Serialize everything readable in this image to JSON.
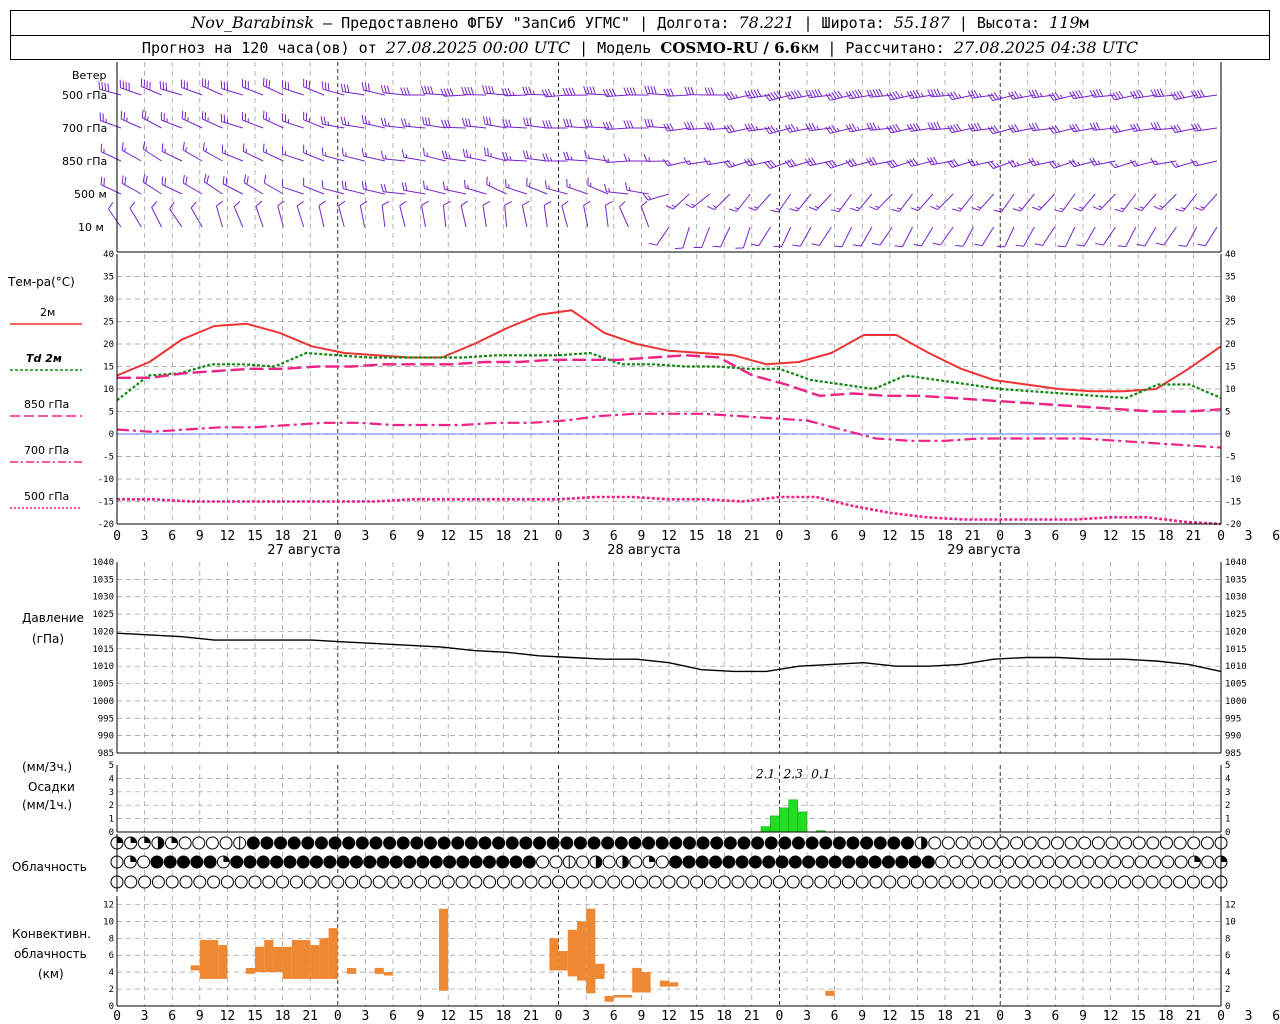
{
  "header": {
    "station": "Nov_Barabinsk",
    "provider": "— Предоставлено ФГБУ \"ЗапСиб УГМС\"",
    "lon_label": "Долгота:",
    "lon": "78.221",
    "lat_label": "Широта:",
    "lat": "55.187",
    "alt_label": "Высота:",
    "alt": "119",
    "alt_unit": "м",
    "forecast_prefix": "Прогноз на 120 часа(ов) от",
    "forecast_from": "27.08.2025 00:00 UTC",
    "model_label": "Модель",
    "model": "COSMO-RU / 6.6",
    "model_unit": "км",
    "calc_label": "Рассчитано:",
    "calc_time": "27.08.2025 04:38 UTC"
  },
  "labels": {
    "wind": "Ветер",
    "wind_levels": [
      "500 гПа",
      "700 гПа",
      "850 гПа",
      "500 м",
      "10 м"
    ],
    "temp_title": "Тем-ра(°C)",
    "temp_legend": [
      "2м",
      "Td 2м",
      "850 гПа",
      "700 гПа",
      "500 гПа"
    ],
    "pressure_title": "Давление",
    "pressure_unit": "(гПа)",
    "precip_unit3": "(мм/3ч.)",
    "precip_title": "Осадки",
    "precip_unit1": "(мм/1ч.)",
    "cloud_title": "Облачность",
    "conv_title1": "Конвективн.",
    "conv_title2": "облачность",
    "conv_unit": "(км)",
    "days": [
      "27 августа",
      "28 августа",
      "29 августа"
    ]
  },
  "colors": {
    "t2m": "#ee3333",
    "td2m": "#118811",
    "t850": "#ee2288",
    "t700": "#ee2288",
    "t500": "#ee2288",
    "wind": "#7722cc",
    "precip": "#22dd22",
    "conv": "#ee8833"
  },
  "chart_data": [
    {
      "type": "line",
      "title": "Тем-ра(°C)",
      "x_hours": [
        0,
        3,
        6,
        9,
        12,
        15,
        18,
        21,
        24,
        27,
        30,
        33,
        36,
        39,
        42,
        45,
        48,
        51,
        54,
        57,
        60,
        63,
        66,
        69,
        72,
        75,
        78,
        81,
        84,
        87,
        90,
        93,
        96,
        99,
        102,
        105,
        108,
        111,
        114,
        117,
        120
      ],
      "x_tick_labels": [
        "0",
        "3",
        "6",
        "9",
        "12",
        "15",
        "18",
        "21",
        "0",
        "3",
        "6",
        "9",
        "12",
        "15",
        "18",
        "21",
        "0",
        "3",
        "6",
        "9",
        "12",
        "15",
        "18",
        "21",
        "0",
        "3",
        "6",
        "9",
        "12",
        "15",
        "18",
        "21",
        "0",
        "3",
        "6",
        "9",
        "12",
        "15",
        "18",
        "21",
        "0",
        "3",
        "6"
      ],
      "ylim": [
        -20,
        40
      ],
      "y_ticks": [
        40,
        35,
        30,
        25,
        20,
        15,
        10,
        5,
        0,
        -5,
        -10,
        -15,
        -20
      ],
      "series": [
        {
          "name": "2м",
          "values": [
            13,
            16,
            21,
            24,
            24.5,
            22.5,
            19.5,
            18,
            17.5,
            17,
            17,
            20,
            23.5,
            26.5,
            27.5,
            22.5,
            20,
            18.5,
            18,
            17.5,
            15.5,
            16,
            18,
            22,
            22,
            18,
            14.5,
            12,
            11,
            10,
            9.5,
            9.5,
            10,
            14.5,
            19.5
          ]
        },
        {
          "name": "Td 2м",
          "values": [
            7.5,
            13,
            13.5,
            15.5,
            15.5,
            15,
            18,
            17.5,
            17,
            17,
            17,
            17,
            17.5,
            17.5,
            17.5,
            18,
            15.5,
            15.5,
            15,
            15,
            14.5,
            14.5,
            12,
            11,
            10,
            13,
            12,
            11,
            10,
            9.5,
            9,
            8.5,
            8,
            11,
            11,
            8
          ]
        },
        {
          "name": "850 гПа",
          "values": [
            12.5,
            12.5,
            13.5,
            14,
            14.5,
            14.5,
            15,
            15,
            15.5,
            15.5,
            15.5,
            16,
            16,
            16.5,
            16.5,
            16.5,
            17,
            17.5,
            17,
            13,
            11,
            8.5,
            9,
            8.5,
            8.5,
            8,
            7.5,
            7,
            6.5,
            6,
            5.5,
            5,
            5,
            5.5
          ]
        },
        {
          "name": "700 гПа",
          "values": [
            1,
            0.5,
            1,
            1.5,
            1.5,
            2,
            2.5,
            2.5,
            2,
            2,
            2,
            2.5,
            2.5,
            3,
            4,
            4.5,
            4.5,
            4.5,
            4,
            3.5,
            3,
            1,
            -1,
            -1.5,
            -1.5,
            -1,
            -1,
            -1,
            -1,
            -1.5,
            -2,
            -2.5,
            -3
          ]
        },
        {
          "name": "500 гПа",
          "values": [
            -14.5,
            -14.5,
            -15,
            -15,
            -15,
            -15,
            -15,
            -15,
            -14.5,
            -14.5,
            -14.5,
            -14.5,
            -14.5,
            -14,
            -14,
            -14.5,
            -14.5,
            -15,
            -14,
            -14,
            -16,
            -17.5,
            -18.5,
            -19,
            -19,
            -19,
            -19,
            -18.5,
            -18.5,
            -19.5,
            -20
          ]
        }
      ]
    },
    {
      "type": "line",
      "title": "Давление",
      "ylabel": "(гПа)",
      "ylim": [
        985,
        1040
      ],
      "y_ticks": [
        1040,
        1035,
        1030,
        1025,
        1020,
        1015,
        1010,
        1005,
        1000,
        995,
        990,
        985
      ],
      "series": [
        {
          "values": [
            1019.5,
            1019,
            1018.5,
            1017.5,
            1017.5,
            1017.5,
            1017.5,
            1017,
            1016.5,
            1016,
            1015.5,
            1014.5,
            1014,
            1013,
            1012.5,
            1012,
            1012,
            1011,
            1009,
            1008.5,
            1008.5,
            1010,
            1010.5,
            1011,
            1010,
            1010,
            1010.5,
            1012,
            1012.5,
            1012.5,
            1012,
            1012,
            1011.5,
            1010.5,
            1008.5
          ]
        }
      ]
    },
    {
      "type": "bar",
      "title": "Осадки",
      "ylabel": "(мм/3ч.) (мм/1ч.)",
      "ylim": [
        0,
        5
      ],
      "y_ticks": [
        5,
        4,
        3,
        2,
        1,
        0
      ],
      "bars": [
        {
          "hour": 70,
          "value": 0.4
        },
        {
          "hour": 71,
          "value": 1.2
        },
        {
          "hour": 72,
          "value": 1.8
        },
        {
          "hour": 73,
          "value": 2.4
        },
        {
          "hour": 74,
          "value": 1.5
        },
        {
          "hour": 76,
          "value": 0.1
        }
      ],
      "annotations": [
        {
          "hour": 70.5,
          "text": "2.1"
        },
        {
          "hour": 73.5,
          "text": "2.3"
        },
        {
          "hour": 76.5,
          "text": "0.1"
        }
      ]
    },
    {
      "type": "bar",
      "title": "Конвективн. облачность",
      "ylabel": "(км)",
      "ylim": [
        0,
        13
      ],
      "y_ticks": [
        12,
        10,
        8,
        6,
        4,
        2,
        0
      ],
      "ranges": [
        {
          "h0": 8,
          "h1": 9,
          "bottom": 4.2,
          "top": 4.8
        },
        {
          "h0": 9,
          "h1": 11,
          "bottom": 3.2,
          "top": 7.8
        },
        {
          "h0": 11,
          "h1": 12,
          "bottom": 3.2,
          "top": 7.2
        },
        {
          "h0": 14,
          "h1": 15,
          "bottom": 3.8,
          "top": 4.5
        },
        {
          "h0": 15,
          "h1": 16,
          "bottom": 4,
          "top": 7
        },
        {
          "h0": 16,
          "h1": 17,
          "bottom": 4,
          "top": 7.8
        },
        {
          "h0": 17,
          "h1": 18,
          "bottom": 4,
          "top": 7
        },
        {
          "h0": 18,
          "h1": 19,
          "bottom": 3.2,
          "top": 7
        },
        {
          "h0": 19,
          "h1": 21,
          "bottom": 3.2,
          "top": 7.8
        },
        {
          "h0": 21,
          "h1": 22,
          "bottom": 3.2,
          "top": 7.2
        },
        {
          "h0": 22,
          "h1": 23,
          "bottom": 3.2,
          "top": 8
        },
        {
          "h0": 23,
          "h1": 24,
          "bottom": 3.2,
          "top": 9.2
        },
        {
          "h0": 25,
          "h1": 26,
          "bottom": 3.8,
          "top": 4.5
        },
        {
          "h0": 28,
          "h1": 29,
          "bottom": 3.8,
          "top": 4.5
        },
        {
          "h0": 29,
          "h1": 30,
          "bottom": 3.6,
          "top": 4.0
        },
        {
          "h0": 35,
          "h1": 36,
          "bottom": 1.8,
          "top": 11.5
        },
        {
          "h0": 47,
          "h1": 48,
          "bottom": 4.2,
          "top": 8
        },
        {
          "h0": 48,
          "h1": 49,
          "bottom": 4.2,
          "top": 6.5
        },
        {
          "h0": 49,
          "h1": 50,
          "bottom": 3.5,
          "top": 9
        },
        {
          "h0": 50,
          "h1": 51,
          "bottom": 3,
          "top": 10
        },
        {
          "h0": 51,
          "h1": 52,
          "bottom": 1.5,
          "top": 11.5
        },
        {
          "h0": 52,
          "h1": 53,
          "bottom": 3.2,
          "top": 5
        },
        {
          "h0": 53,
          "h1": 54,
          "bottom": 0.5,
          "top": 1.2
        },
        {
          "h0": 54,
          "h1": 56,
          "bottom": 1,
          "top": 1.3
        },
        {
          "h0": 56,
          "h1": 57,
          "bottom": 1.6,
          "top": 4.5
        },
        {
          "h0": 57,
          "h1": 58,
          "bottom": 1.6,
          "top": 4
        },
        {
          "h0": 59,
          "h1": 60,
          "bottom": 2.3,
          "top": 3
        },
        {
          "h0": 60,
          "h1": 61,
          "bottom": 2.3,
          "top": 2.8
        },
        {
          "h0": 77,
          "h1": 78,
          "bottom": 1.2,
          "top": 1.8
        }
      ]
    },
    {
      "type": "table",
      "title": "Облачность",
      "rows": [
        "QQQHQOOOOLFFFFFFFFFFFFFFFFFFFFFFFFFFFFFFFFFFFFFFFFFFFFFFFFFHOOOOOOOOOOOOOOOOOOOOOO",
        "OQOFFFFFQFFFFFFFFFFFFFFFFFFFFFFFOOLOHOHOQOFFFFFFFFFFFFFFFFFFFFOOOOOOOOOOOOOOOOOOOQOQ",
        "OOOOOOOOOOOOOOOOOOOOOOOOOOOOOOOOOOOOOOOOOOOOOOOOOOOOOOOOOOOOOOOOOOOOOOOOOOOOOOOOO"
      ]
    },
    {
      "type": "scatter",
      "title": "Ветер",
      "levels": [
        "500 гПа",
        "700 гПа",
        "850 гПа",
        "500 м",
        "10 м"
      ],
      "directions_deg": [
        [
          290,
          290,
          290,
          290,
          290,
          290,
          290,
          290,
          290,
          280,
          280,
          270,
          270,
          270,
          270,
          270,
          270,
          270,
          270,
          270,
          270,
          270,
          265,
          260,
          260,
          260,
          260,
          260,
          260,
          260,
          260,
          260,
          260,
          260,
          260,
          260,
          260,
          260,
          260,
          260,
          260
        ],
        [
          295,
          295,
          295,
          295,
          290,
          290,
          290,
          290,
          285,
          280,
          280,
          275,
          275,
          275,
          275,
          275,
          275,
          275,
          270,
          270,
          270,
          265,
          260,
          260,
          260,
          260,
          260,
          260,
          260,
          260,
          260,
          260,
          260,
          260,
          260,
          260,
          260,
          260,
          260,
          260,
          260
        ],
        [
          300,
          300,
          300,
          300,
          295,
          295,
          290,
          290,
          290,
          285,
          280,
          280,
          280,
          280,
          280,
          275,
          275,
          275,
          275,
          270,
          265,
          260,
          255,
          255,
          255,
          255,
          255,
          255,
          255,
          255,
          255,
          255,
          255,
          255,
          255,
          255,
          255,
          255,
          255,
          255,
          255
        ],
        [
          300,
          300,
          300,
          300,
          300,
          300,
          295,
          290,
          290,
          285,
          280,
          280,
          280,
          285,
          290,
          290,
          290,
          290,
          290,
          280,
          250,
          230,
          220,
          220,
          220,
          220,
          220,
          220,
          220,
          220,
          220,
          220,
          220,
          220,
          220,
          220,
          220,
          220,
          220,
          220,
          220
        ],
        [
          330,
          330,
          330,
          330,
          340,
          340,
          340,
          345,
          350,
          350,
          350,
          350,
          350,
          350,
          350,
          350,
          350,
          350,
          350,
          340,
          210,
          200,
          200,
          200,
          210,
          210,
          210,
          210,
          210,
          210,
          210,
          210,
          210,
          210,
          210,
          210,
          210,
          210,
          210,
          210,
          210
        ]
      ],
      "speeds_ms": [
        [
          18,
          18,
          17,
          17,
          16,
          16,
          16,
          16,
          15,
          15,
          16,
          17,
          18,
          19,
          19,
          20,
          20,
          19,
          18,
          18,
          18,
          17,
          17,
          20,
          25,
          27,
          27,
          26,
          25,
          24,
          23,
          22,
          22,
          21,
          20,
          20,
          19,
          19,
          18,
          18,
          18
        ],
        [
          14,
          14,
          14,
          14,
          13,
          13,
          13,
          13,
          13,
          13,
          14,
          14,
          15,
          16,
          16,
          16,
          16,
          16,
          15,
          15,
          15,
          15,
          15,
          17,
          20,
          22,
          22,
          21,
          20,
          19,
          19,
          18,
          18,
          17,
          17,
          16,
          16,
          16,
          15,
          15,
          15
        ],
        [
          11,
          11,
          11,
          11,
          10,
          10,
          10,
          10,
          10,
          10,
          11,
          11,
          12,
          13,
          13,
          13,
          13,
          13,
          12,
          12,
          12,
          12,
          12,
          14,
          16,
          17,
          17,
          17,
          16,
          16,
          15,
          15,
          14,
          14,
          13,
          13,
          13,
          12,
          12,
          12,
          12
        ],
        [
          8,
          8,
          8,
          8,
          8,
          8,
          7,
          7,
          7,
          8,
          8,
          9,
          10,
          10,
          10,
          10,
          10,
          10,
          10,
          10,
          10,
          10,
          10,
          11,
          12,
          12,
          12,
          12,
          11,
          11,
          11,
          11,
          10,
          10,
          10,
          10,
          10,
          10,
          10,
          10,
          10
        ],
        [
          4,
          4,
          4,
          4,
          4,
          4,
          4,
          4,
          5,
          5,
          5,
          5,
          5,
          5,
          5,
          5,
          5,
          5,
          5,
          5,
          5,
          5,
          6,
          6,
          6,
          6,
          6,
          6,
          6,
          6,
          6,
          6,
          6,
          6,
          6,
          6,
          6,
          6,
          6,
          6,
          6
        ]
      ]
    }
  ]
}
